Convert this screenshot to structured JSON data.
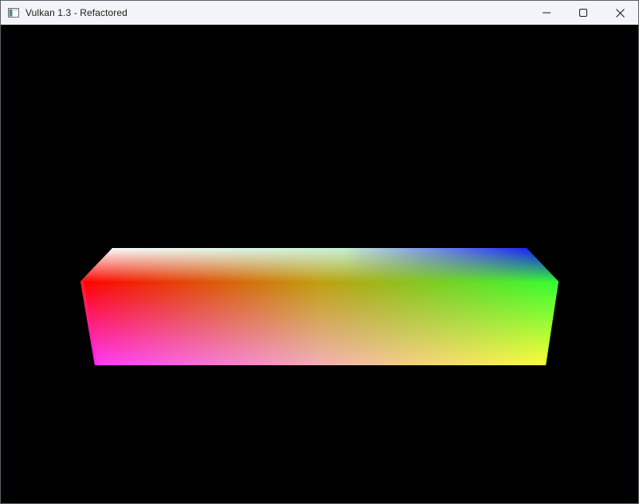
{
  "window": {
    "title": "Vulkan 1.3 - Refactored",
    "icons": {
      "app": "app-window-icon",
      "minimize": "minimize-icon",
      "maximize": "maximize-icon",
      "close": "close-icon"
    }
  },
  "scene": {
    "object": "rainbow-box",
    "background_color": "#000000",
    "vertex_colors": {
      "top_back_left": "#ffffff",
      "top_back_right": "#0000ff",
      "front_top_left": "#ff0000",
      "front_top_right": "#33ff33",
      "front_bottom_left": "#ff33ff",
      "front_bottom_right": "#ffff33"
    }
  }
}
